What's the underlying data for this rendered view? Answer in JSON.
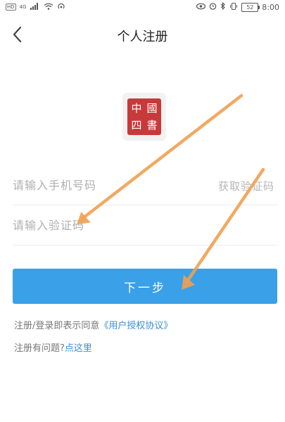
{
  "status_bar": {
    "badge": "HD",
    "network": "4G",
    "battery": "52",
    "time": "8:00"
  },
  "header": {
    "title": "个人注册"
  },
  "logo": {
    "chars": [
      "中",
      "國",
      "四",
      "書"
    ]
  },
  "form": {
    "phone_placeholder": "请输入手机号码",
    "get_code_label": "获取验证码",
    "code_placeholder": "请输入验证码",
    "next_label": "下一步"
  },
  "footer": {
    "agreement_prefix": "注册/登录即表示同意",
    "agreement_link": "《用户授权协议》",
    "help_prefix": "注册有问题?",
    "help_link": "点这里"
  },
  "colors": {
    "accent": "#3aa0e8",
    "link": "#3a8fd6",
    "annotation_arrow": "#f0a050",
    "seal": "#c73a3a"
  }
}
